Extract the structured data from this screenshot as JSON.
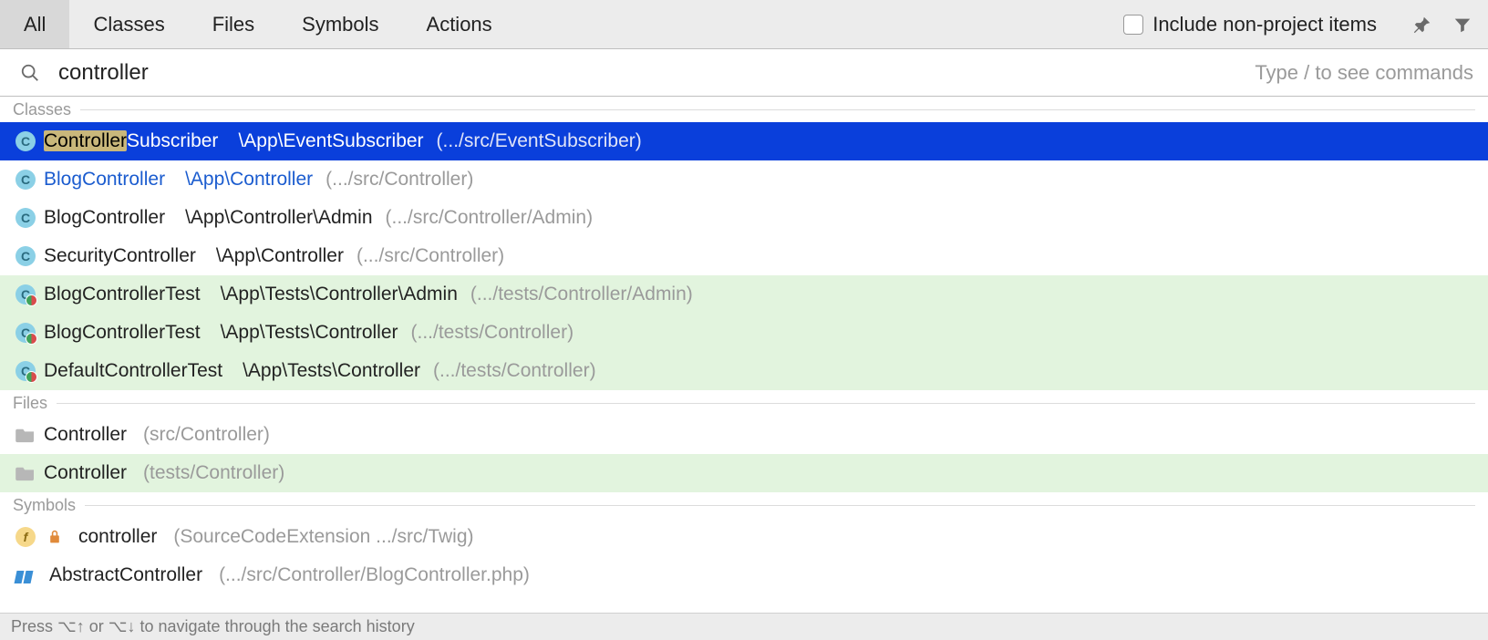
{
  "tabs": {
    "all": "All",
    "classes": "Classes",
    "files": "Files",
    "symbols": "Symbols",
    "actions": "Actions"
  },
  "include_nonproject_label": "Include non-project items",
  "search": {
    "value": "controller",
    "hint": "Type / to see commands"
  },
  "sections": {
    "classes": "Classes",
    "files": "Files",
    "symbols": "Symbols"
  },
  "class_results": [
    {
      "name_hl": "Controller",
      "name_rest": "Subscriber",
      "namespace": "\\App\\EventSubscriber",
      "path": "(.../src/EventSubscriber)",
      "icon": "class",
      "selected": true,
      "test": false,
      "prior": false
    },
    {
      "name_hl": "",
      "name_rest": "BlogController",
      "namespace": "\\App\\Controller",
      "path": "(.../src/Controller)",
      "icon": "class",
      "selected": false,
      "test": false,
      "prior": true
    },
    {
      "name_hl": "",
      "name_rest": "BlogController",
      "namespace": "\\App\\Controller\\Admin",
      "path": "(.../src/Controller/Admin)",
      "icon": "class",
      "selected": false,
      "test": false,
      "prior": false
    },
    {
      "name_hl": "",
      "name_rest": "SecurityController",
      "namespace": "\\App\\Controller",
      "path": "(.../src/Controller)",
      "icon": "class",
      "selected": false,
      "test": false,
      "prior": false
    },
    {
      "name_hl": "",
      "name_rest": "BlogControllerTest",
      "namespace": "\\App\\Tests\\Controller\\Admin",
      "path": "(.../tests/Controller/Admin)",
      "icon": "testclass",
      "selected": false,
      "test": true,
      "prior": false
    },
    {
      "name_hl": "",
      "name_rest": "BlogControllerTest",
      "namespace": "\\App\\Tests\\Controller",
      "path": "(.../tests/Controller)",
      "icon": "testclass",
      "selected": false,
      "test": true,
      "prior": false
    },
    {
      "name_hl": "",
      "name_rest": "DefaultControllerTest",
      "namespace": "\\App\\Tests\\Controller",
      "path": "(.../tests/Controller)",
      "icon": "testclass",
      "selected": false,
      "test": true,
      "prior": false
    }
  ],
  "file_results": [
    {
      "name": "Controller",
      "path": "(src/Controller)",
      "icon": "folder",
      "test": false
    },
    {
      "name": "Controller",
      "path": "(tests/Controller)",
      "icon": "folder",
      "test": true
    }
  ],
  "symbol_results": [
    {
      "name": "controller",
      "path": "(SourceCodeExtension .../src/Twig)",
      "icons": [
        "field",
        "lock"
      ]
    },
    {
      "name": "AbstractController",
      "path": "(.../src/Controller/BlogController.php)",
      "icons": [
        "abstract"
      ]
    }
  ],
  "footer_hint": "Press ⌥↑ or ⌥↓ to navigate through the search history"
}
